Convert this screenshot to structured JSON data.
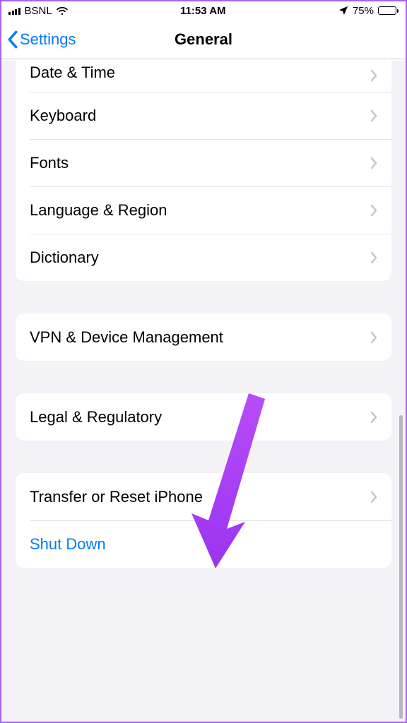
{
  "status": {
    "carrier": "BSNL",
    "time": "11:53 AM",
    "battery_pct": "75%"
  },
  "nav": {
    "back_label": "Settings",
    "title": "General"
  },
  "group1": {
    "items": [
      {
        "label": "Date & Time"
      },
      {
        "label": "Keyboard"
      },
      {
        "label": "Fonts"
      },
      {
        "label": "Language & Region"
      },
      {
        "label": "Dictionary"
      }
    ]
  },
  "group2": {
    "items": [
      {
        "label": "VPN & Device Management"
      }
    ]
  },
  "group3": {
    "items": [
      {
        "label": "Legal & Regulatory"
      }
    ]
  },
  "group4": {
    "items": [
      {
        "label": "Transfer or Reset iPhone"
      },
      {
        "label": "Shut Down"
      }
    ]
  }
}
